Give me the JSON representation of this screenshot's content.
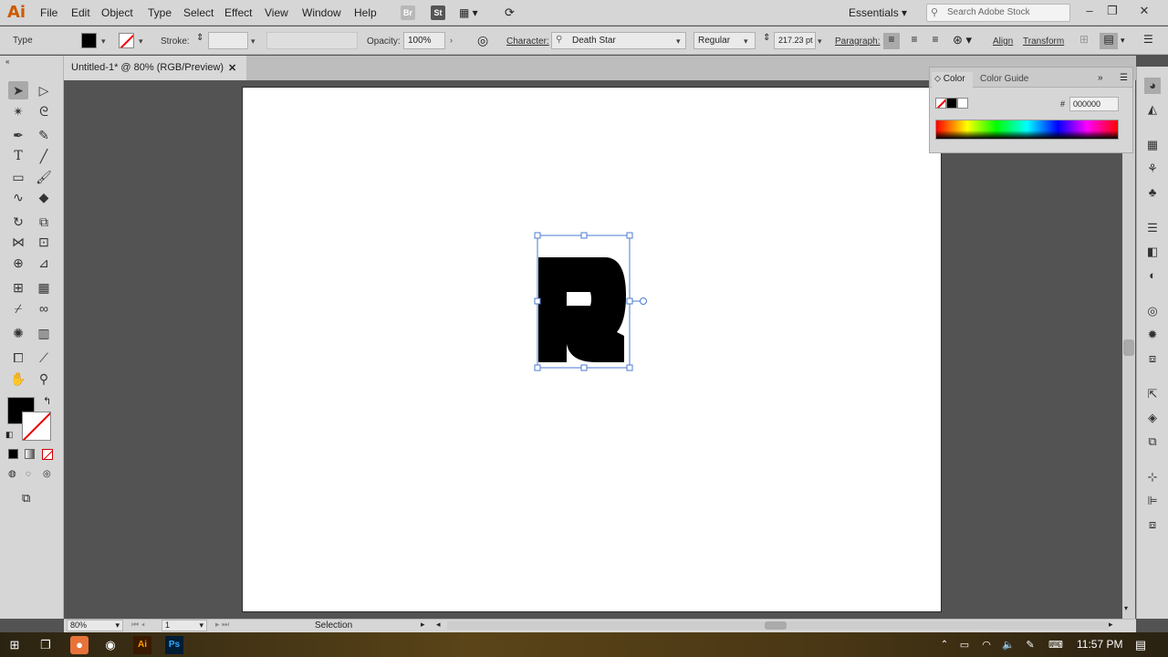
{
  "app": {
    "logo": "Ai"
  },
  "menu": [
    "File",
    "Edit",
    "Object",
    "Type",
    "Select",
    "Effect",
    "View",
    "Window",
    "Help"
  ],
  "menubar_icons": {
    "bridge": "Br",
    "stock": "St"
  },
  "workspace": "Essentials",
  "stock_search": {
    "placeholder": "Search Adobe Stock"
  },
  "control_bar": {
    "mode_label": "Type",
    "stroke_label": "Stroke:",
    "opacity_label": "Opacity:",
    "opacity_value": "100%",
    "character_label": "Character:",
    "font_family": "Death Star",
    "font_style": "Regular",
    "font_size": "217.23 pt",
    "paragraph_label": "Paragraph:",
    "align_label": "Align",
    "transform_label": "Transform"
  },
  "document": {
    "tab_title": "Untitled-1* @ 80% (RGB/Preview)"
  },
  "color_panel": {
    "tabs": [
      "Color",
      "Color Guide"
    ],
    "hex_label": "#",
    "hex_value": "000000"
  },
  "status_bar": {
    "zoom": "80%",
    "artboard_number": "1",
    "tool_name": "Selection"
  },
  "taskbar": {
    "time": "11:57 PM"
  },
  "colors": {
    "accent": "#cc5a00",
    "fill": "#000000"
  }
}
